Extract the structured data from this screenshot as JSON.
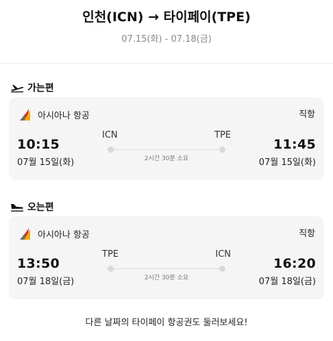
{
  "header": {
    "title": "인천(ICN) → 타이페이(TPE)",
    "dates": "07.15(화) - 07.18(금)"
  },
  "outbound": {
    "label": "가는편",
    "airline": "아시아나 항공",
    "type": "직항",
    "dep_time": "10:15",
    "dep_date": "07월 15일(화)",
    "dep_code": "ICN",
    "arr_time": "11:45",
    "arr_date": "07월 15일(화)",
    "arr_code": "TPE",
    "duration": "2시간 30분 소요"
  },
  "inbound": {
    "label": "오는편",
    "airline": "아시아나 항공",
    "type": "직항",
    "dep_time": "13:50",
    "dep_date": "07월 18일(금)",
    "dep_code": "TPE",
    "arr_time": "16:20",
    "arr_date": "07월 18일(금)",
    "arr_code": "ICN",
    "duration": "2시간 30분 소요"
  },
  "footer": {
    "text": "다른 날짜의 타이페이 항공권도 둘러보세요!"
  },
  "icons": {
    "departure": "plane-takeoff-icon",
    "arrival": "plane-landing-icon",
    "airline_logo": "asiana-logo-icon"
  }
}
